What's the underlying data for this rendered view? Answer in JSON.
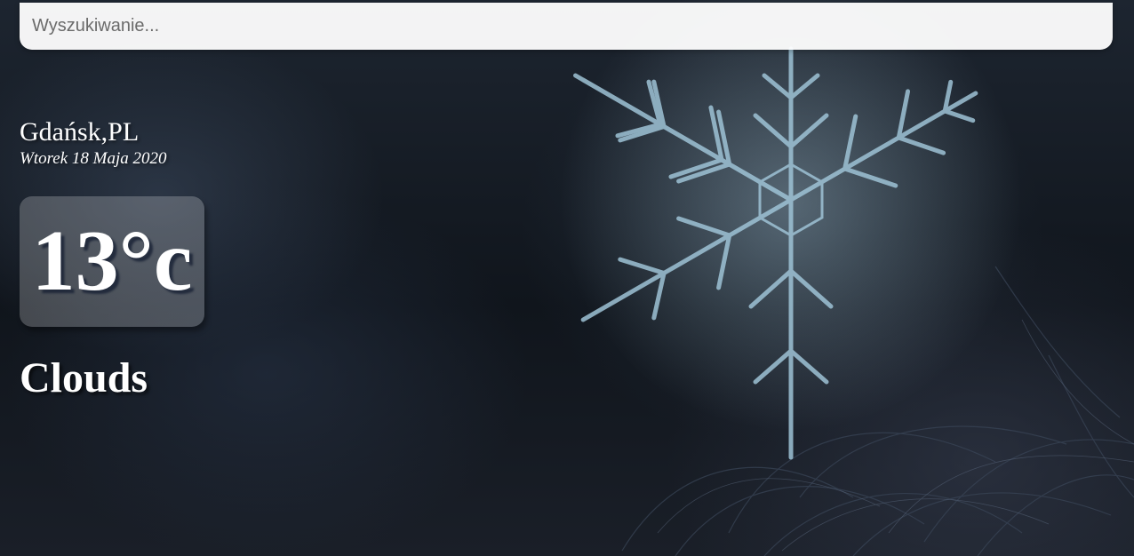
{
  "search": {
    "placeholder": "Wyszukiwanie..."
  },
  "weather": {
    "location": "Gdańsk,PL",
    "date": "Wtorek 18 Maja 2020",
    "temperature": "13°c",
    "condition": "Clouds"
  },
  "background": {
    "icon": "snowflake-photo",
    "colors": {
      "dark": "#10151c",
      "ice": "#9fc3d6"
    }
  }
}
